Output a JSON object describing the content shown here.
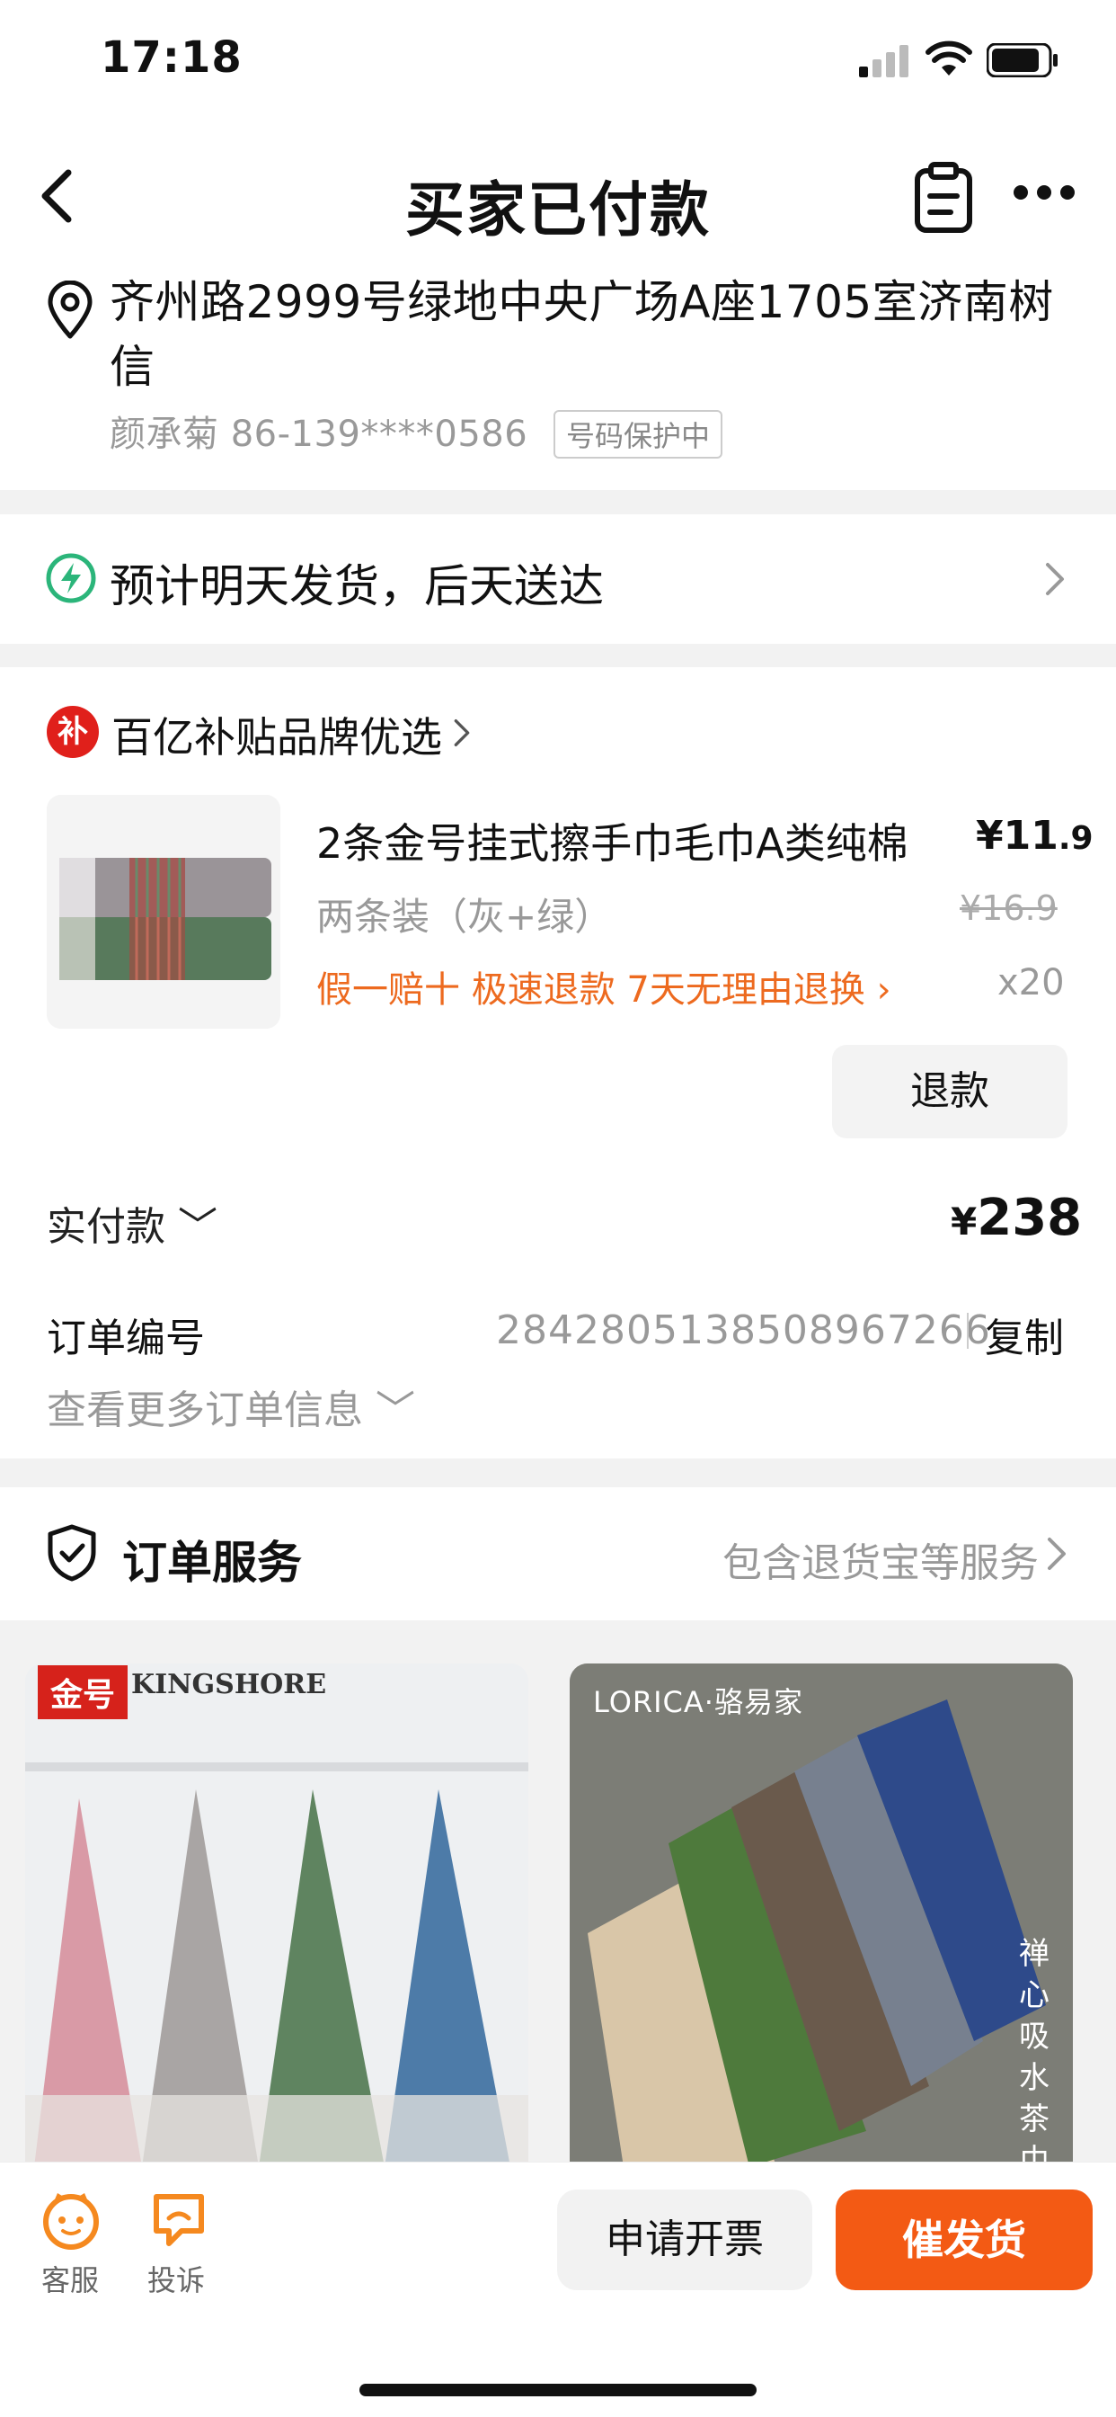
{
  "status_bar": {
    "time": "17:18"
  },
  "header": {
    "title": "买家已付款"
  },
  "address": {
    "text": "齐州路2999号绿地中央广场A座1705室济南树信",
    "contact": "颜承菊 86-139****0586",
    "badge": "号码保护中"
  },
  "shipping": {
    "text": "预计明天发货，后天送达"
  },
  "product_section": {
    "brand": "百亿补贴品牌优选",
    "brand_logo_char": "补",
    "item": {
      "title": "2条金号挂式擦手巾毛巾A类纯棉",
      "price_int": "¥11",
      "price_dec": ".9",
      "spec": "两条装（灰+绿）",
      "original_price": "¥16.9",
      "tags": "假一赔十  极速退款  7天无理由退换 ›",
      "quantity": "x20"
    },
    "refund_label": "退款",
    "paid_label": "实付款 ﹀",
    "paid_currency": "¥",
    "paid_amount": "238",
    "order_label": "订单编号",
    "order_number": "2842805138508967266",
    "copy_label": "复制",
    "more_info": "查看更多订单信息 ﹀"
  },
  "services": {
    "title": "订单服务",
    "right_text": "包含退货宝等服务"
  },
  "recommendations": [
    {
      "brand_red": "金号",
      "brand": "KINGSHORE"
    },
    {
      "brand": "LORICA·骆易家",
      "side_text": "禅心吸水茶巾"
    }
  ],
  "bottom_bar": {
    "customer_service": "客服",
    "complaint": "投诉",
    "invoice": "申请开票",
    "urge": "催发货"
  },
  "colors": {
    "accent": "#f35a14",
    "tag_orange": "#ed6a1f",
    "subsidy_red": "#e0201b",
    "ship_green": "#2bb57a"
  }
}
